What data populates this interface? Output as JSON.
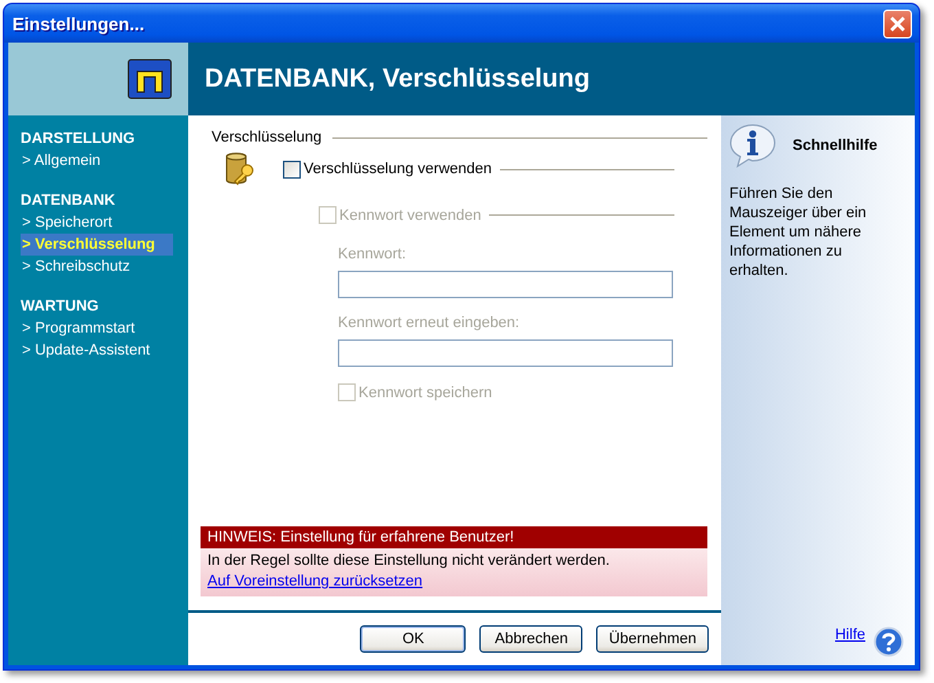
{
  "window": {
    "title": "Einstellungen..."
  },
  "sidebar": {
    "groups": [
      {
        "heading": "DARSTELLUNG",
        "items": [
          {
            "label": "> Allgemein",
            "selected": false
          }
        ]
      },
      {
        "heading": "DATENBANK",
        "items": [
          {
            "label": "> Speicherort",
            "selected": false
          },
          {
            "label": "> Verschlüsselung",
            "selected": true
          },
          {
            "label": "> Schreibschutz",
            "selected": false
          }
        ]
      },
      {
        "heading": "WARTUNG",
        "items": [
          {
            "label": "> Programmstart",
            "selected": false
          },
          {
            "label": "> Update-Assistent",
            "selected": false
          }
        ]
      }
    ]
  },
  "page": {
    "title": "DATENBANK, Verschlüsselung",
    "section": "Verschlüsselung",
    "encrypt": {
      "label": "Verschlüsselung verwenden",
      "checked": false,
      "disabled": false
    },
    "use_password": {
      "label": "Kennwort verwenden",
      "checked": false,
      "disabled": true
    },
    "fields": [
      {
        "label": "Kennwort:",
        "disabled": true
      },
      {
        "label": "Kennwort erneut eingeben:",
        "disabled": true
      }
    ],
    "save_password": {
      "label": "Kennwort speichern",
      "checked": false,
      "disabled": true
    }
  },
  "notice": {
    "title": "HINWEIS: Einstellung für erfahrene Benutzer!",
    "text": "In der Regel sollte diese Einstellung nicht verändert werden.",
    "link": "Auf Voreinstellung zurücksetzen"
  },
  "buttons": [
    {
      "label": "OK",
      "default": true
    },
    {
      "label": "Abbrechen",
      "default": false
    },
    {
      "label": "Übernehmen",
      "default": false
    }
  ],
  "help": {
    "title": "Schnellhilfe",
    "text": "Führen Sie den Mauszeiger über ein Element um nähere Informationen zu erhalten.",
    "link": "Hilfe"
  }
}
